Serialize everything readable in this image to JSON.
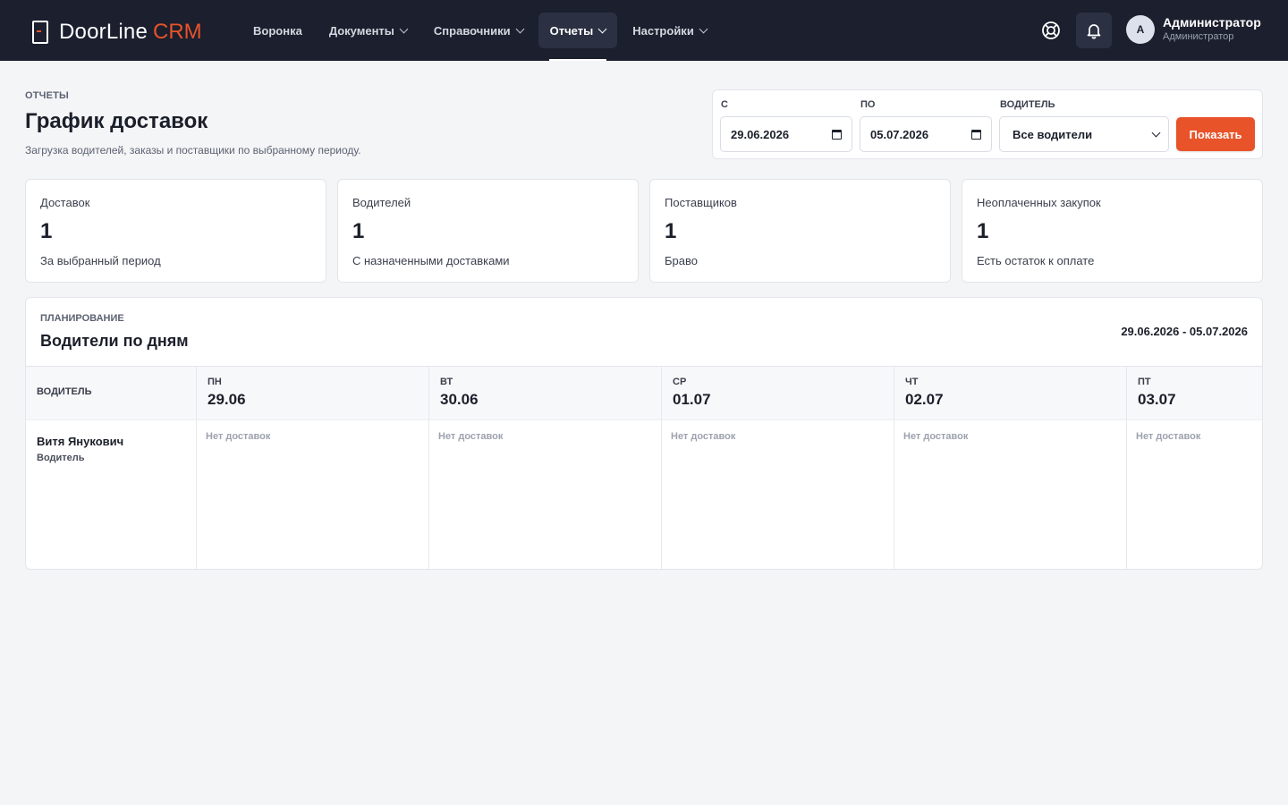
{
  "app": {
    "logo_text": "DoorLine",
    "logo_accent": "CRM",
    "accent_color": "#e8532a"
  },
  "nav": {
    "items": [
      {
        "label": "Воронка"
      },
      {
        "label": "Документы"
      },
      {
        "label": "Справочники"
      },
      {
        "label": "Отчеты"
      },
      {
        "label": "Настройки"
      }
    ],
    "active": "Отчеты"
  },
  "user": {
    "initial": "А",
    "name": "Администратор",
    "role": "Администратор"
  },
  "header": {
    "eyebrow": "ОТЧЕТЫ",
    "title": "График доставок",
    "subtitle": "Загрузка водителей, заказы и поставщики по выбранному периоду."
  },
  "filters": {
    "from_label": "С",
    "from_value": "29.06.2026",
    "to_label": "ПО",
    "to_value": "05.07.2026",
    "driver_label": "ВОДИТЕЛЬ",
    "driver_value": "Все водители",
    "submit_label": "Показать"
  },
  "stats": [
    {
      "label": "Доставок",
      "value": "1",
      "note": "За выбранный период"
    },
    {
      "label": "Водителей",
      "value": "1",
      "note": "С назначенными доставками"
    },
    {
      "label": "Поставщиков",
      "value": "1",
      "note": "Браво"
    },
    {
      "label": "Неоплаченных закупок",
      "value": "1",
      "note": "Есть остаток к оплате"
    }
  ],
  "schedule": {
    "eyebrow": "ПЛАНИРОВАНИЕ",
    "title": "Водители по дням",
    "range": "29.06.2026 - 05.07.2026",
    "driver_header": "ВОДИТЕЛЬ",
    "days": [
      {
        "name": "ПН",
        "date": "29.06"
      },
      {
        "name": "ВТ",
        "date": "30.06"
      },
      {
        "name": "СР",
        "date": "01.07"
      },
      {
        "name": "ЧТ",
        "date": "02.07"
      },
      {
        "name": "ПТ",
        "date": "03.07"
      }
    ],
    "rows": [
      {
        "driver": "Витя Янукович",
        "role": "Водитель",
        "cells": [
          "Нет доставок",
          "Нет доставок",
          "Нет доставок",
          "Нет доставок",
          "Нет доставок"
        ]
      }
    ]
  }
}
